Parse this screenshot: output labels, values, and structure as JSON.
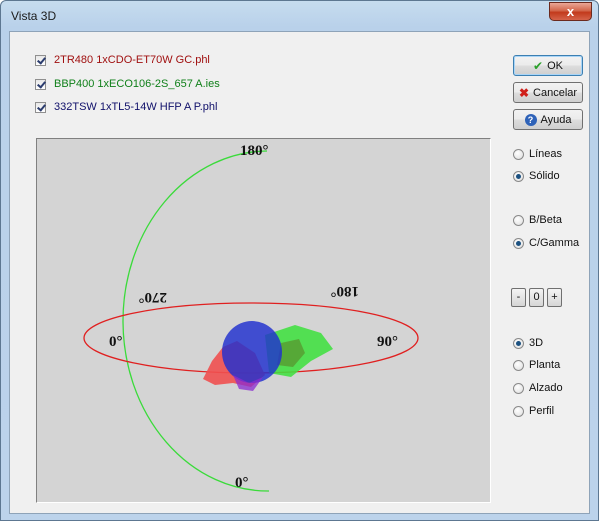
{
  "window": {
    "title": "Vista 3D",
    "close_label": "x"
  },
  "files": [
    {
      "name": "2TR480 1xCDO-ET70W GC.phl",
      "checked": true,
      "color": "#a01010"
    },
    {
      "name": "BBP400 1xECO106-2S_657 A.ies",
      "checked": true,
      "color": "#10801a"
    },
    {
      "name": "332TSW 1xTL5-14W HFP A P.phl",
      "checked": true,
      "color": "#10106a"
    }
  ],
  "buttons": {
    "ok": {
      "label": "OK",
      "icon": "check-icon"
    },
    "cancel": {
      "label": "Cancelar",
      "icon": "red-x-icon"
    },
    "help": {
      "label": "Ayuda",
      "icon": "help-icon"
    }
  },
  "render_mode": {
    "options": [
      "Líneas",
      "Sólido"
    ],
    "selected": "Sólido"
  },
  "coordinate_system": {
    "options": [
      "B/Beta",
      "C/Gamma"
    ],
    "selected": "C/Gamma"
  },
  "stepper": {
    "minus": "-",
    "value": "0",
    "plus": "+"
  },
  "view_mode": {
    "options": [
      "3D",
      "Planta",
      "Alzado",
      "Perfil"
    ],
    "selected": "3D"
  },
  "viewport": {
    "labels": {
      "top_180": "180°",
      "bottom_0": "0°",
      "left_0": "0°",
      "right_90": "90°",
      "back_270": "270°",
      "back_180": "180°"
    },
    "colors": {
      "background": "#d4d4d4",
      "vertical_circle": "#3adb3a",
      "horizontal_circle": "#e02020",
      "solid_red": "#f05050",
      "solid_green": "#40e040",
      "solid_blue": "#2030d0"
    }
  }
}
